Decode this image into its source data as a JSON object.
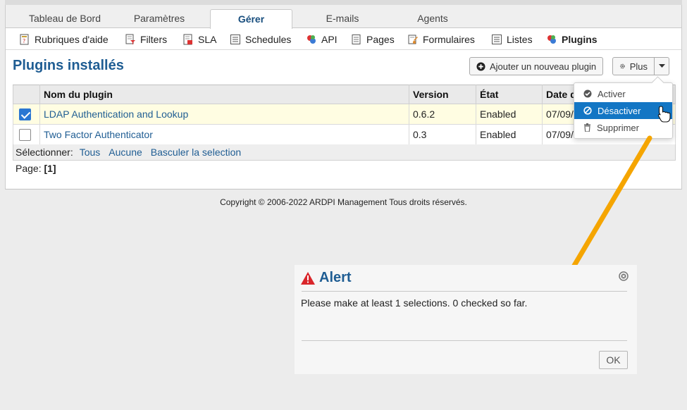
{
  "tabs": [
    {
      "label": "Tableau de Bord"
    },
    {
      "label": "Paramètres"
    },
    {
      "label": "Gérer"
    },
    {
      "label": "E-mails"
    },
    {
      "label": "Agents"
    }
  ],
  "subnav": [
    {
      "label": "Rubriques d'aide",
      "icon": "help-topics-icon"
    },
    {
      "label": "Filters",
      "icon": "filter-icon"
    },
    {
      "label": "SLA",
      "icon": "sla-icon"
    },
    {
      "label": "Schedules",
      "icon": "schedule-icon"
    },
    {
      "label": "API",
      "icon": "api-icon"
    },
    {
      "label": "Pages",
      "icon": "pages-icon"
    },
    {
      "label": "Formulaires",
      "icon": "forms-icon"
    },
    {
      "label": "Listes",
      "icon": "lists-icon"
    },
    {
      "label": "Plugins",
      "icon": "plugins-icon"
    }
  ],
  "page": {
    "title": "Plugins installés",
    "add_button": "Ajouter un nouveau plugin",
    "more_button": "Plus"
  },
  "table": {
    "headers": [
      "Nom du plugin",
      "Version",
      "État",
      "Date d"
    ],
    "rows": [
      {
        "name": "LDAP Authentication and Lookup",
        "version": "0.6.2",
        "state": "Enabled",
        "date": "07/09/",
        "checked": true
      },
      {
        "name": "Two Factor Authenticator",
        "version": "0.3",
        "state": "Enabled",
        "date": "07/09/",
        "checked": false
      }
    ]
  },
  "selection": {
    "label": "Sélectionner:",
    "all": "Tous",
    "none": "Aucune",
    "toggle": "Basculer la selection"
  },
  "pager": {
    "label": "Page:",
    "current": "[1]"
  },
  "dropdown": {
    "items": [
      {
        "label": "Activer",
        "icon": "check-circle-icon"
      },
      {
        "label": "Désactiver",
        "icon": "ban-icon"
      },
      {
        "label": "Supprimer",
        "icon": "trash-icon"
      }
    ]
  },
  "footer": {
    "copyright": "Copyright © 2006-2022 ARDPI Management Tous droits réservés."
  },
  "alert": {
    "title": "Alert",
    "message": "Please make at least 1 selections. 0 checked so far.",
    "ok": "OK"
  },
  "colors": {
    "accent": "#1f5d93",
    "highlight": "#1376c4",
    "arrow": "#f5a500",
    "alert_icon": "#d9262b",
    "selected_row": "#fffde2"
  }
}
